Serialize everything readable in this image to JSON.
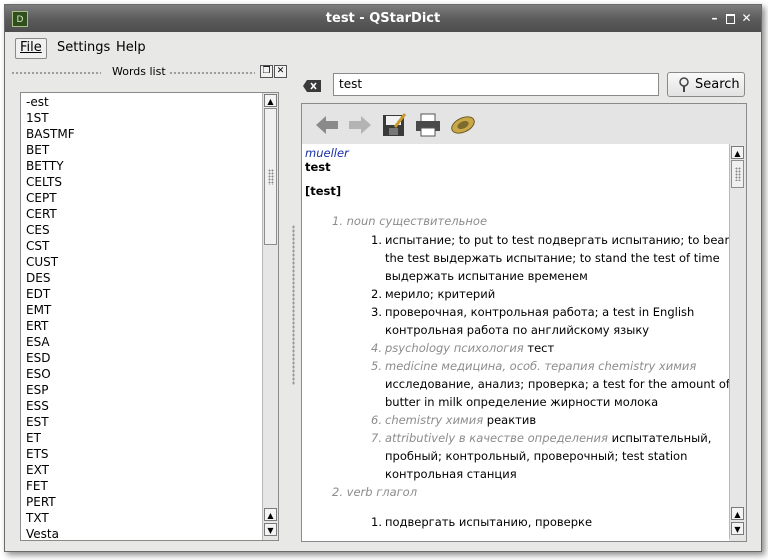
{
  "window": {
    "title": "test - QStarDict",
    "icon_letter": "D"
  },
  "menu": [
    "File",
    "Settings",
    "Help"
  ],
  "dock": {
    "title": "Words list"
  },
  "words": [
    "-est",
    "1ST",
    "BASTMF",
    "BET",
    "BETTY",
    "CELTS",
    "CEPT",
    "CERT",
    "CES",
    "CST",
    "CUST",
    "DES",
    "EDT",
    "EMT",
    "ERT",
    "ESA",
    "ESD",
    "ESO",
    "ESP",
    "ESS",
    "EST",
    "ET",
    "ETS",
    "EXT",
    "FET",
    "PERT",
    "TXT",
    "Vesta"
  ],
  "search": {
    "value": "test",
    "button_label": "Search"
  },
  "toolbar": [
    "back-icon",
    "forward-icon",
    "save-icon",
    "print-icon",
    "speak-icon"
  ],
  "article": {
    "dict_name": "mueller",
    "headword": "test",
    "transcription": "[test]",
    "pos1_num": "1.",
    "pos1": "noun существительное",
    "m1_num": "1.",
    "m1_l1": "испытание; to put to test подвергать испытанию; to bear",
    "m1_l2": "the test выдержать испытание; to stand the test of time",
    "m1_l3": "выдержать испытание временем",
    "m2_num": "2.",
    "m2": "мерило; критерий",
    "m3_num": "3.",
    "m3_l1": "проверочная, контрольная работа; a test in English",
    "m3_l2": "контрольная работа по английскому языку",
    "m4_num": "4.",
    "m4_label": "psychology психология",
    "m4": "тест",
    "m5_num": "5.",
    "m5_label": "medicine медицина, особ. терапия chemistry химия",
    "m5_l1": "исследование, анализ; проверка; a test for the amount of",
    "m5_l2": "butter in milk определение жирности молока",
    "m6_num": "6.",
    "m6_label": "chemistry химия",
    "m6": "реактив",
    "m7_num": "7.",
    "m7_label": "attributively в качестве определения",
    "m7_l1": "испытательный,",
    "m7_l2": "пробный; контрольный, проверочный; test station",
    "m7_l3": "контрольная станция",
    "pos2_num": "2.",
    "pos2": "verb глагол",
    "v1_num": "1.",
    "v1": "подвергать испытанию, проверке"
  }
}
